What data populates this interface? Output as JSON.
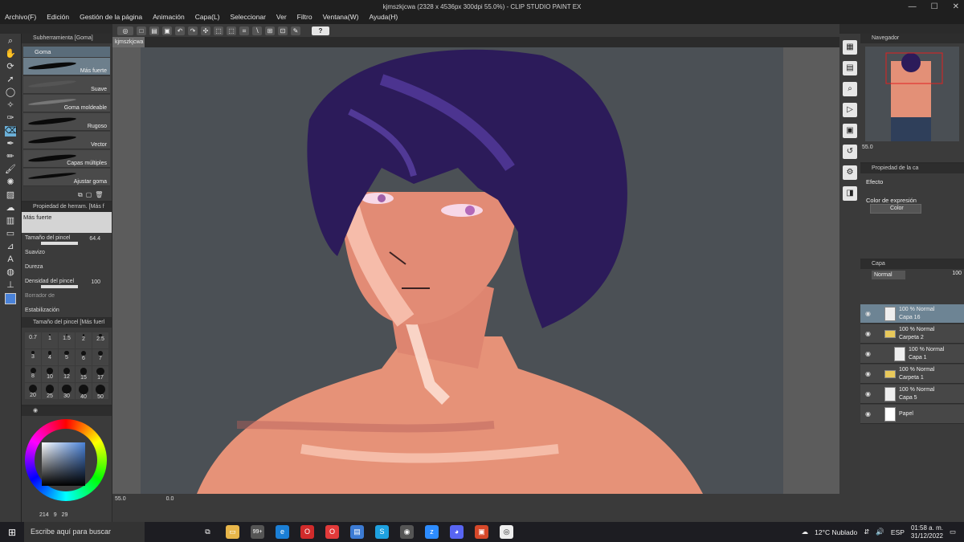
{
  "window": {
    "title": "kjmszkjcwa (2328 x 4536px 300dpi 55.0%)  - CLIP STUDIO PAINT EX",
    "min": "—",
    "max": "☐",
    "close": "✕"
  },
  "menu": [
    "Archivo(F)",
    "Edición",
    "Gestión de la página",
    "Animación",
    "Capa(L)",
    "Seleccionar",
    "Ver",
    "Filtro",
    "Ventana(W)",
    "Ayuda(H)"
  ],
  "command_bar": {
    "help": "?"
  },
  "subtool_panel": {
    "header": "Subherramienta [Goma]",
    "group": "Goma",
    "brushes": [
      "Más fuerte",
      "Suave",
      "Goma moldeable",
      "Rugoso",
      "Vector",
      "Capas múltiples",
      "Ajustar goma"
    ],
    "selected_index": 0
  },
  "tool_property": {
    "header": "Propiedad de herram. [Más f",
    "name": "Más fuerte",
    "brush_size_label": "Tamaño del pincel",
    "brush_size_value": "64.4",
    "softness_label": "Suavizo",
    "hardness_label": "Dureza",
    "density_label": "Densidad del pincel",
    "density_value": "100",
    "erase_label": "Borrador de",
    "stabilization_label": "Estabilización"
  },
  "brush_size_panel": {
    "header": "Tamaño del pincel [Más fuerl",
    "sizes": [
      "0.7",
      "1",
      "1.5",
      "2",
      "2.5",
      "3",
      "4",
      "5",
      "6",
      "7",
      "8",
      "10",
      "12",
      "15",
      "17",
      "20",
      "25",
      "30",
      "40",
      "50"
    ]
  },
  "color_panel": {
    "h_value": "214",
    "s_value": "9",
    "v_value": "29",
    "accent": "#4a82d8"
  },
  "document": {
    "tab": "kjmszkjcwa",
    "zoom": "55.0",
    "rotation": "0.0"
  },
  "navigator": {
    "header": "Navegador",
    "zoom": "55.0"
  },
  "effect_panel": {
    "header": "Propiedad de la ca",
    "effect_label": "Efecto",
    "expression_label": "Color de expresión",
    "expression_value": "Color"
  },
  "layer_panel": {
    "header": "Capa",
    "blend_mode": "Normal",
    "opacity": "100",
    "layers": [
      {
        "blend": "100 % Normal",
        "name": "Capa 16",
        "selected": true,
        "type": "raster"
      },
      {
        "blend": "100 % Normal",
        "name": "Carpeta 2",
        "selected": false,
        "type": "folder"
      },
      {
        "blend": "100 % Normal",
        "name": "Capa 1",
        "selected": false,
        "type": "raster"
      },
      {
        "blend": "100 % Normal",
        "name": "Carpeta 1",
        "selected": false,
        "type": "folder"
      },
      {
        "blend": "100 % Normal",
        "name": "Capa 5",
        "selected": false,
        "type": "raster"
      },
      {
        "blend": "",
        "name": "Papel",
        "selected": false,
        "type": "paper"
      }
    ]
  },
  "taskbar": {
    "search_placeholder": "Escribe aquí para buscar",
    "badge": "99+",
    "weather": "12°C  Nublado",
    "time": "01:58 a. m.",
    "date": "31/12/2022",
    "lang": "ESP"
  }
}
